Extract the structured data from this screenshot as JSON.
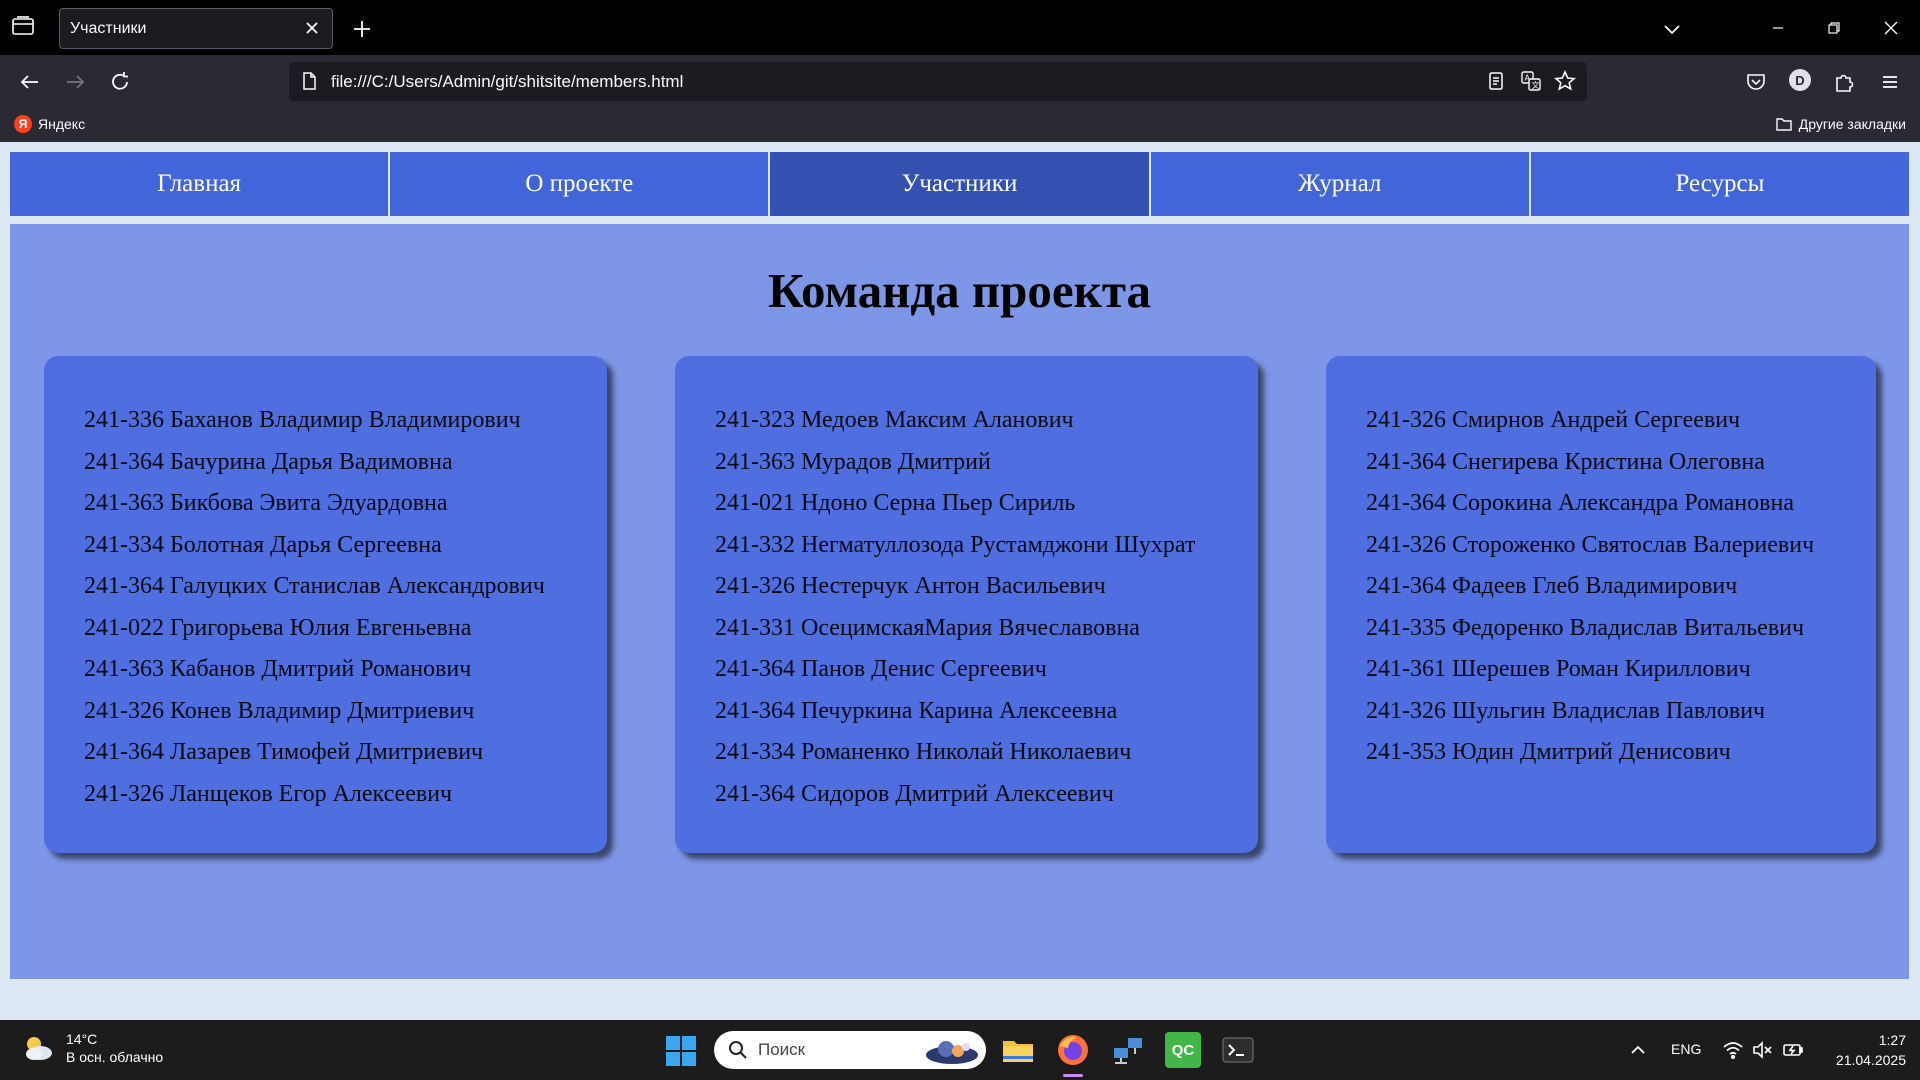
{
  "browser": {
    "tab_title": "Участники",
    "url": "file:///C:/Users/Admin/git/shitsite/members.html",
    "avatar_letter": "D",
    "bookmarks": {
      "yandex_label": "Яндекс",
      "yandex_logo": "Я",
      "other_label": "Другие закладки"
    }
  },
  "site": {
    "nav": [
      "Главная",
      "О проекте",
      "Участники",
      "Журнал",
      "Ресурсы"
    ],
    "active_nav": "Участники",
    "title": "Команда проекта",
    "columns": [
      [
        "241-336 Баханов Владимир Владимирович",
        "241-364 Бачурина Дарья Вадимовна",
        "241-363 Бикбова Эвита Эдуардовна",
        "241-334 Болотная Дарья Сергеевна",
        "241-364 Галуцких Станислав Александрович",
        "241-022 Григорьева Юлия Евгеньевна",
        "241-363 Кабанов Дмитрий Романович",
        "241-326 Конев Владимир Дмитриевич",
        "241-364 Лазарев Тимофей Дмитриевич",
        "241-326 Ланщеков Егор Алексеевич"
      ],
      [
        "241-323 Медоев Максим Аланович",
        "241-363 Мурадов Дмитрий",
        "241-021 Ндоно Серна Пьер Сириль",
        "241-332 Негматуллозода Рустамджони Шухрат",
        "241-326 Нестерчук Антон Васильевич",
        "241-331 ОсецимскаяМария Вячеславовна",
        "241-364 Панов Денис Сергеевич",
        "241-364 Печуркина Карина Алексеевна",
        "241-334 Романенко Николай Николаевич",
        "241-364 Сидоров Дмитрий Алексеевич"
      ],
      [
        "241-326 Смирнов Андрей Сергеевич",
        "241-364 Снегирева Кристина Олеговна",
        "241-364 Сорокина Александра Романовна",
        "241-326 Стороженко Святослав Валериевич",
        "241-364 Фадеев Глеб Владимирович",
        "241-335 Федоренко Владислав Витальевич",
        "241-361 Шерешев Роман Кириллович",
        "241-326 Шульгин Владислав Павлович",
        "241-353 Юдин Дмитрий Денисович"
      ]
    ]
  },
  "taskbar": {
    "weather_temp": "14°C",
    "weather_desc": "В осн. облачно",
    "search_placeholder": "Поиск",
    "qc_label": "QC",
    "lang": "ENG",
    "time": "1:27",
    "date": "21.04.2025"
  },
  "colors": {
    "nav_bg": "#4365da",
    "nav_active_bg": "#3451b1",
    "main_bg": "#7d96e8",
    "card_bg": "#4f6ee0"
  }
}
